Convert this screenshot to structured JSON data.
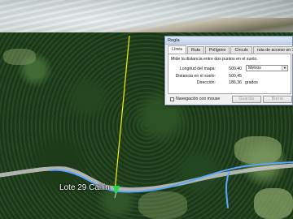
{
  "map": {
    "placemark_label": "Lote 29 Cailín",
    "ruler_line_color": "#f4f400",
    "path_color": "#5aa6ff",
    "road_color": "#c9c9c9",
    "pin_color": "#22d84a",
    "pin_icon": "pushpin-icon"
  },
  "dialog": {
    "title": "Regla",
    "tabs": [
      {
        "label": "Línea",
        "active": true
      },
      {
        "label": "Ruta",
        "active": false
      },
      {
        "label": "Polígono",
        "active": false
      },
      {
        "label": "Círculo",
        "active": false
      },
      {
        "label": "ruta de acceso en 3D",
        "active": false
      }
    ],
    "instruction": "Mide la distancia entre dos puntos en el suelo.",
    "map_length": {
      "label": "Longitud del mapa:",
      "value": "500,40"
    },
    "unit_select": {
      "selected": "Metros"
    },
    "ground_length": {
      "label": "Distancia en el suelo:",
      "value": "500,45"
    },
    "heading": {
      "label": "Dirección:",
      "value": "186,36",
      "unit": "grados"
    },
    "mouse_nav": {
      "label": "Navegación con mouse",
      "checked": false
    },
    "save_button": "Guardar",
    "clear_button": "Borrar"
  }
}
